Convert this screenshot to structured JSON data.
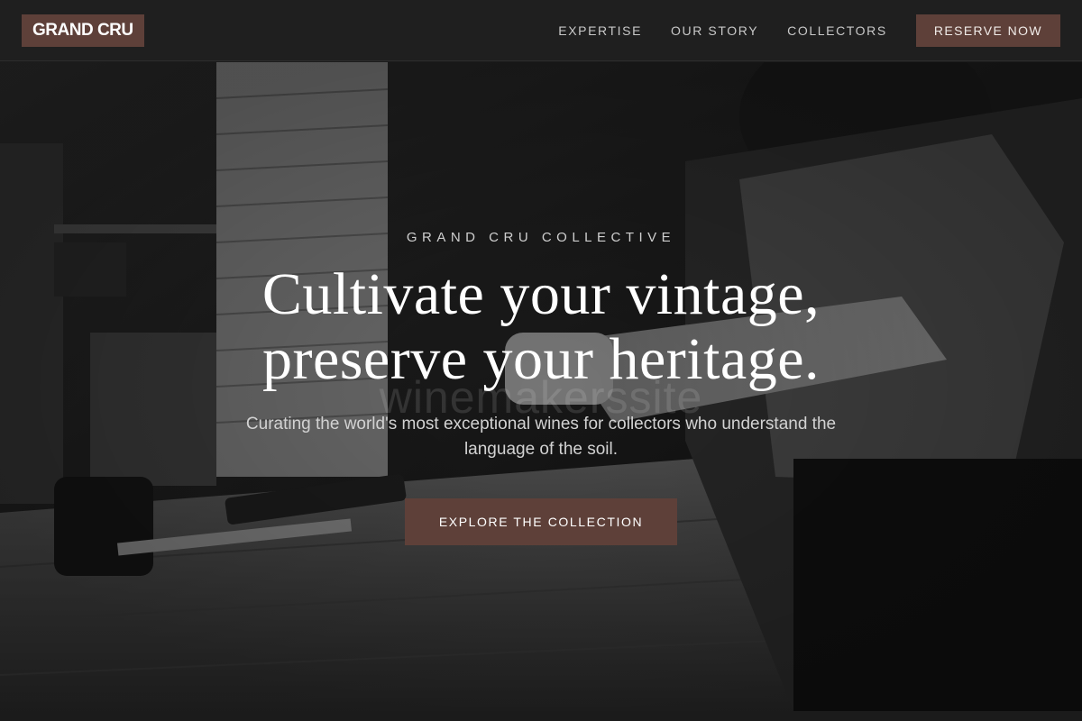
{
  "header": {
    "logo": "GRAND CRU",
    "nav": [
      {
        "label": "EXPERTISE"
      },
      {
        "label": "OUR STORY"
      },
      {
        "label": "COLLECTORS"
      }
    ],
    "cta_label": "RESERVE NOW"
  },
  "hero": {
    "eyebrow": "GRAND CRU COLLECTIVE",
    "headline_line1": "Cultivate your vintage,",
    "headline_line2": "preserve your heritage.",
    "watermark": "winemakerssite",
    "subline": "Curating the world's most exceptional wines for collectors who understand the language of the soil.",
    "cta_label": "EXPLORE THE COLLECTION"
  },
  "colors": {
    "accent": "#5e4039",
    "header_bg": "#1f1f1f"
  }
}
